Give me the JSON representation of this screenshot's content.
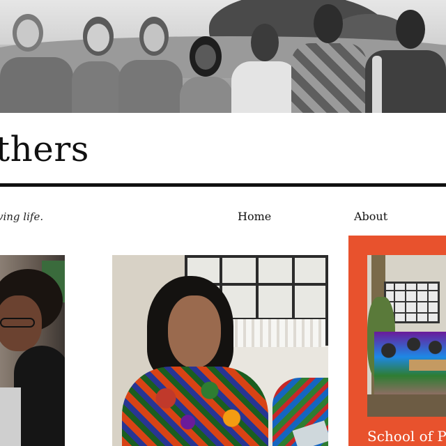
{
  "hero": {
    "alt": "Group photo of team members"
  },
  "site": {
    "title": "thers",
    "tagline": "ving life."
  },
  "nav": {
    "home_label": "Home",
    "about_label": "About"
  },
  "cards": [
    {
      "image_alt": "Woman smiling at a computer"
    },
    {
      "image_alt": "Woman in embroidered blouse reading"
    },
    {
      "image_alt": "Classroom of students",
      "title": "School of PO"
    }
  ],
  "colors": {
    "accent": "#e8522d",
    "text": "#111111",
    "background": "#ffffff"
  }
}
